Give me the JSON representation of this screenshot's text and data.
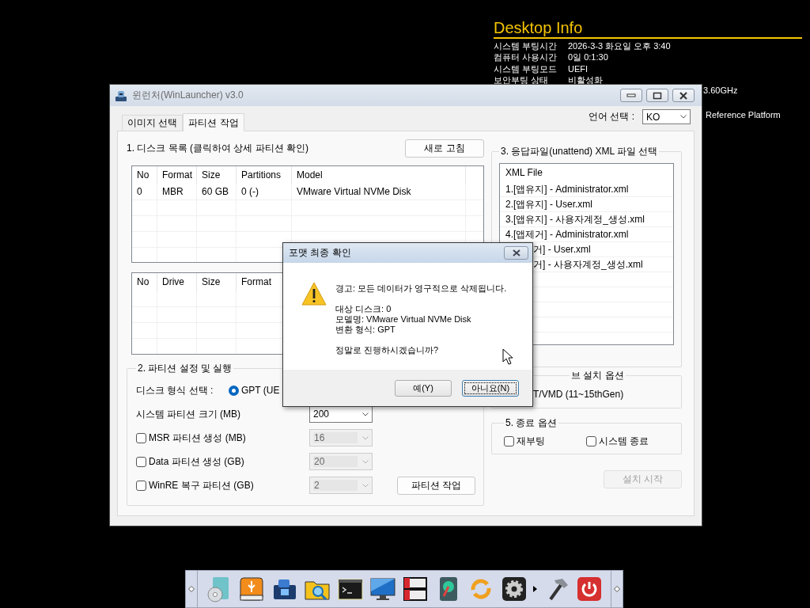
{
  "desktop_info": {
    "title": "Desktop Info",
    "rows": [
      {
        "label": "시스템 부팅시간",
        "value": "2026-3-3 화요일 오후 3:40"
      },
      {
        "label": "컴퓨터 사용시간",
        "value": "0일 0:1:30"
      },
      {
        "label": "시스템 부팅모드",
        "value": "UEFI"
      },
      {
        "label": "보안부팅 상태",
        "value": "비활성화"
      }
    ],
    "clipped_values": [
      "3.60GHz",
      "Reference Platform"
    ]
  },
  "window": {
    "title": "윈런처(WinLauncher) v3.0",
    "tabs": [
      {
        "label": "이미지 선택",
        "selected": false
      },
      {
        "label": "파티션 작업",
        "selected": true
      }
    ],
    "language": {
      "label": "언어 선택 :",
      "value": "KO"
    },
    "disk_list": {
      "title": "1. 디스크 목록 (클릭하여 상세 파티션 확인)",
      "refresh_button": "새로 고침",
      "columns": [
        "No",
        "Format",
        "Size",
        "Partitions",
        "Model"
      ],
      "rows": [
        [
          "0",
          "MBR",
          "60 GB",
          "0 (-)",
          "VMware Virtual NVMe Disk"
        ]
      ]
    },
    "partition_list": {
      "columns": [
        "No",
        "Drive",
        "Size",
        "Format"
      ]
    },
    "partition_settings": {
      "title": "2. 파티션 설정 및 실행",
      "format_label": "디스크 형식 선택 :",
      "format_options": [
        {
          "label": "GPT (UE",
          "selected": true
        }
      ],
      "rows": [
        {
          "kind": "select",
          "label": "시스템 파티션 크기 (MB)",
          "value": "200",
          "disabled": false
        },
        {
          "kind": "checkbox",
          "label": "MSR 파티션 생성 (MB)",
          "checked": false,
          "value": "16",
          "disabled": true
        },
        {
          "kind": "checkbox",
          "label": "Data 파티션 생성 (GB)",
          "checked": false,
          "value": "20",
          "disabled": true
        },
        {
          "kind": "checkbox",
          "label": "WinRE 복구 파티션 (GB)",
          "checked": false,
          "value": "2",
          "disabled": true
        }
      ],
      "run_button": "파티션 작업"
    },
    "xml_select": {
      "title": "3. 응답파일(unattend) XML 파일 선택",
      "column": "XML File",
      "items": [
        {
          "kind": "full",
          "label": "1.[앱유지] - Administrator.xml"
        },
        {
          "kind": "full",
          "label": "2.[앱유지] - User.xml"
        },
        {
          "kind": "full",
          "label": "3.[앱유지] - 사용자계정_생성.xml"
        },
        {
          "kind": "full",
          "label": "4.[앱제거] - Administrator.xml"
        },
        {
          "kind": "clipped",
          "label": "거] - User.xml"
        },
        {
          "kind": "clipped",
          "label": "거] - 사용자계정_생성.xml"
        }
      ]
    },
    "native_options": {
      "title": "브 설치 옵션",
      "option": "T/VMD (11~15thGen)"
    },
    "exit_options": {
      "title": "5. 종료 옵션",
      "options": [
        {
          "label": "재부팅",
          "checked": false
        },
        {
          "label": "시스템 종료",
          "checked": false
        }
      ]
    },
    "install_button": {
      "label": "설치 시작",
      "disabled": true
    }
  },
  "dialog": {
    "title": "포맷 최종 확인",
    "paragraphs": [
      [
        "경고: 모든 데이터가 영구적으로 삭제됩니다."
      ],
      [
        "대상 디스크: 0",
        "모델명: VMware Virtual NVMe Disk",
        "변환 형식: GPT"
      ],
      [
        "정말로 진행하시겠습니까?"
      ]
    ],
    "buttons": [
      {
        "label": "예(Y)",
        "focused": false
      },
      {
        "label": "아니요(N)",
        "focused": true
      }
    ]
  }
}
